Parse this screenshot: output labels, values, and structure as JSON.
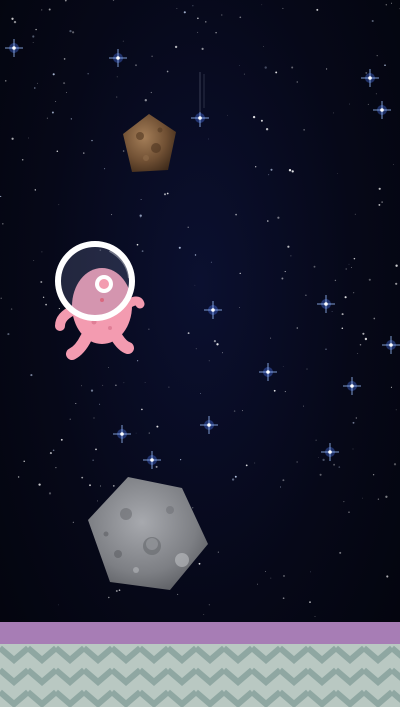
{
  "scene": {
    "type": "space-runner-game",
    "background_color": "#05060f",
    "ground_stripe_color": "#a77db5",
    "ground_zigzag_colors": [
      "#b9c8c2",
      "#8fa7a2"
    ],
    "player": {
      "name": "pink-alien-astronaut",
      "body_color": "#f39bb0",
      "helmet_color": "#ffffff"
    },
    "obstacles": [
      {
        "name": "small-brown-asteroid",
        "color": "#7a5a3c"
      },
      {
        "name": "large-grey-asteroid",
        "color": "#8d8f95"
      }
    ]
  }
}
